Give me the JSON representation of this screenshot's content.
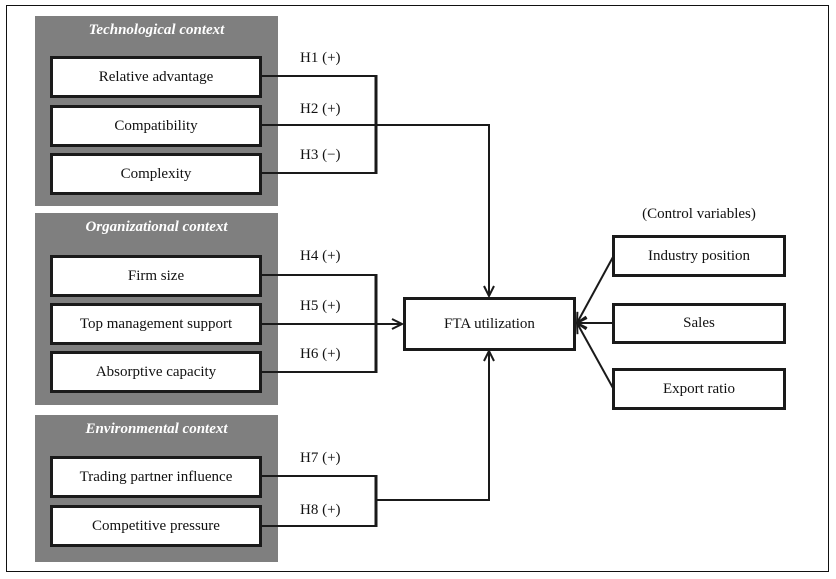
{
  "contexts": [
    {
      "title": "Technological context",
      "factors": [
        "Relative advantage",
        "Compatibility",
        "Complexity"
      ]
    },
    {
      "title": "Organizational context",
      "factors": [
        "Firm size",
        "Top management support",
        "Absorptive capacity"
      ]
    },
    {
      "title": "Environmental context",
      "factors": [
        "Trading partner influence",
        "Competitive pressure"
      ]
    }
  ],
  "hypotheses": [
    "H1 (+)",
    "H2 (+)",
    "H3 (−)",
    "H4 (+)",
    "H5 (+)",
    "H6 (+)",
    "H7 (+)",
    "H8 (+)"
  ],
  "outcome": "FTA utilization",
  "controls": {
    "label": "(Control variables)",
    "items": [
      "Industry position",
      "Sales",
      "Export ratio"
    ]
  }
}
